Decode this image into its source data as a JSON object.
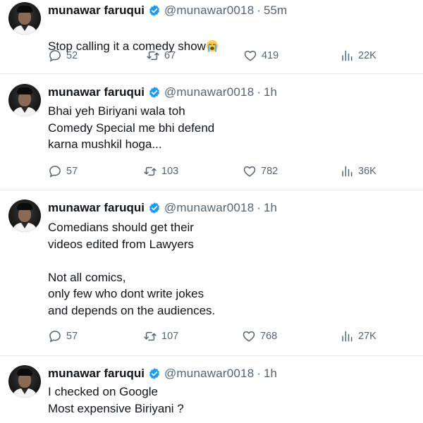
{
  "tweets": [
    {
      "name": "munawar faruqui",
      "handle": "@munawar0018",
      "separator": "·",
      "time": "55m",
      "text": "Stop calling it a comedy show",
      "emoji": "loudly-crying-face",
      "replies": "52",
      "retweets": "67",
      "likes": "419",
      "views": "22K"
    },
    {
      "name": "munawar faruqui",
      "handle": "@munawar0018",
      "separator": "·",
      "time": "1h",
      "text": "Bhai yeh Biriyani wala toh\nComedy Special me bhi defend\nkarna mushkil hoga...",
      "replies": "57",
      "retweets": "103",
      "likes": "782",
      "views": "36K"
    },
    {
      "name": "munawar faruqui",
      "handle": "@munawar0018",
      "separator": "·",
      "time": "1h",
      "text": "Comedians should get their\nvideos edited from Lawyers\n\nNot all comics,\nonly few who dont write jokes\nand depends on the audiences.",
      "replies": "57",
      "retweets": "107",
      "likes": "768",
      "views": "27K"
    },
    {
      "name": "munawar faruqui",
      "handle": "@munawar0018",
      "separator": "·",
      "time": "1h",
      "text": "I checked on Google\nMost expensive Biriyani ?"
    }
  ],
  "icons": {
    "reply": "reply-icon",
    "retweet": "retweet-icon",
    "like": "heart-icon",
    "views": "views-chart-icon",
    "verified": "verified-badge-icon"
  },
  "colors": {
    "verified": "#1d9bf0",
    "secondary_text": "#536471",
    "divider": "#e6e9ec"
  }
}
